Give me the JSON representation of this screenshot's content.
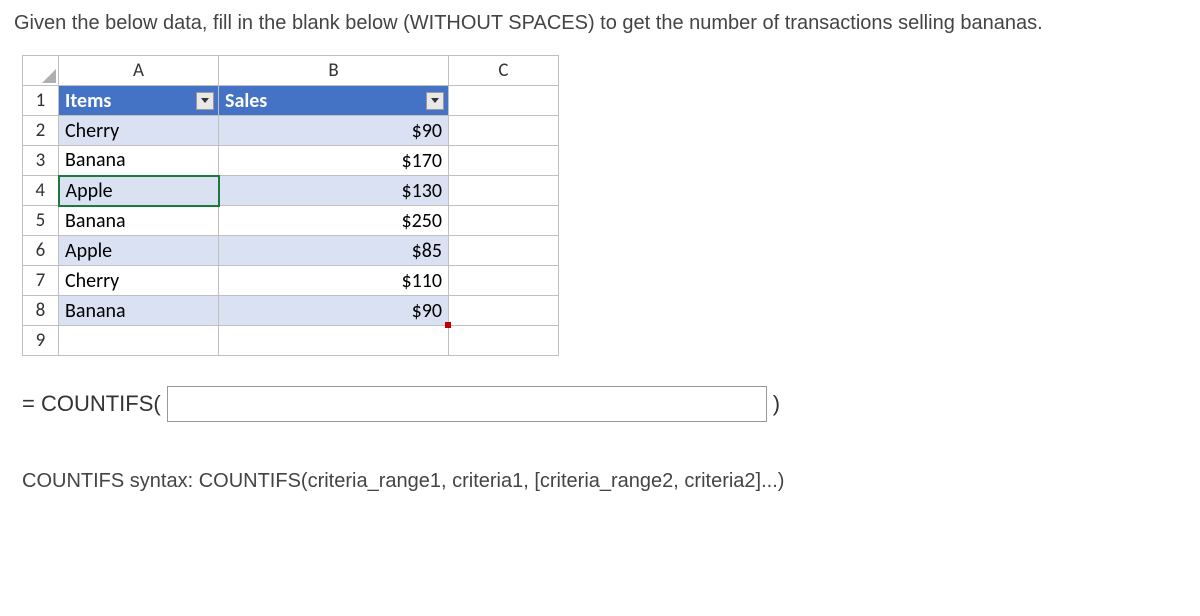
{
  "question": "Given the below data, fill in the blank below (WITHOUT SPACES) to get the number of transactions selling bananas.",
  "columns": {
    "a": "A",
    "b": "B",
    "c": "C"
  },
  "headers": {
    "items": "Items",
    "sales": "Sales"
  },
  "rows": [
    {
      "num": "1"
    },
    {
      "num": "2",
      "item": "Cherry",
      "sales": "$90"
    },
    {
      "num": "3",
      "item": "Banana",
      "sales": "$170"
    },
    {
      "num": "4",
      "item": "Apple",
      "sales": "$130"
    },
    {
      "num": "5",
      "item": "Banana",
      "sales": "$250"
    },
    {
      "num": "6",
      "item": "Apple",
      "sales": "$85"
    },
    {
      "num": "7",
      "item": "Cherry",
      "sales": "$110"
    },
    {
      "num": "8",
      "item": "Banana",
      "sales": "$90"
    },
    {
      "num": "9"
    }
  ],
  "formula": {
    "prefix": "= COUNTIFS(",
    "suffix": ")",
    "value": ""
  },
  "hint": "COUNTIFS syntax: COUNTIFS(criteria_range1, criteria1, [criteria_range2, criteria2]...)"
}
